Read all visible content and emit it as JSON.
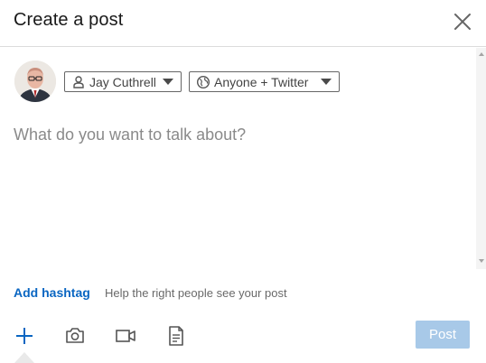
{
  "header": {
    "title": "Create a post"
  },
  "composer": {
    "author_label": "Jay Cuthrell",
    "audience_label": "Anyone + Twitter",
    "placeholder": "What do you want to talk about?"
  },
  "hashtag": {
    "add_label": "Add hashtag",
    "help_text": "Help the right people see your post"
  },
  "toolbar": {
    "post_label": "Post"
  },
  "icons": {
    "close": "close-icon",
    "author": "person-icon",
    "audience": "globe-icon",
    "caret": "caret-down-icon",
    "add": "plus-icon",
    "photo": "camera-icon",
    "video": "video-camera-icon",
    "document": "document-icon"
  },
  "colors": {
    "accent": "#0a66c2",
    "post_button_disabled": "#a8c9e8",
    "divider": "#dcdcdc"
  }
}
